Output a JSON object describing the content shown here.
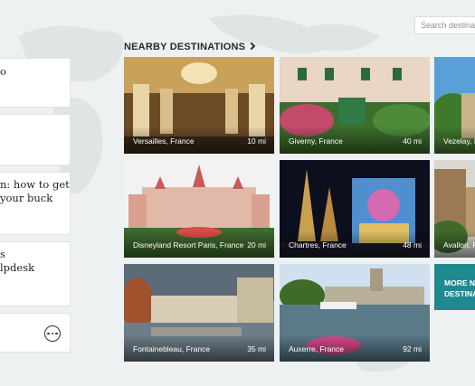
{
  "search": {
    "placeholder": "Search destinations"
  },
  "left_cards": [
    {
      "lines": [
        "o"
      ]
    },
    {
      "lines": []
    },
    {
      "lines": [
        "n: how to get",
        "your buck"
      ]
    },
    {
      "lines": [
        "s",
        "lpdesk"
      ]
    },
    {
      "lines": [],
      "more_icon": "more-options-icon"
    }
  ],
  "nearby": {
    "title": "NEARBY DESTINATIONS",
    "title_icon": "chevron-right-icon",
    "tiles": [
      {
        "name": "Versailles, France",
        "distance": "10 mi"
      },
      {
        "name": "Giverny, France",
        "distance": "40 mi"
      },
      {
        "name": "Vezelay, France",
        "distance": ""
      },
      {
        "name": "Disneyland Resort Paris, France",
        "distance": "20 mi"
      },
      {
        "name": "Chartres, France",
        "distance": "48 mi"
      },
      {
        "name": "Avallon, France",
        "distance": ""
      },
      {
        "name": "Fontainebleau, France",
        "distance": "35 mi"
      },
      {
        "name": "Auxerre, France",
        "distance": "92 mi"
      }
    ],
    "more_tile": [
      "MORE NEARBY",
      "DESTINATIONS"
    ]
  },
  "colors": {
    "accent": "#1e8a8f",
    "background": "#eef1f1"
  }
}
